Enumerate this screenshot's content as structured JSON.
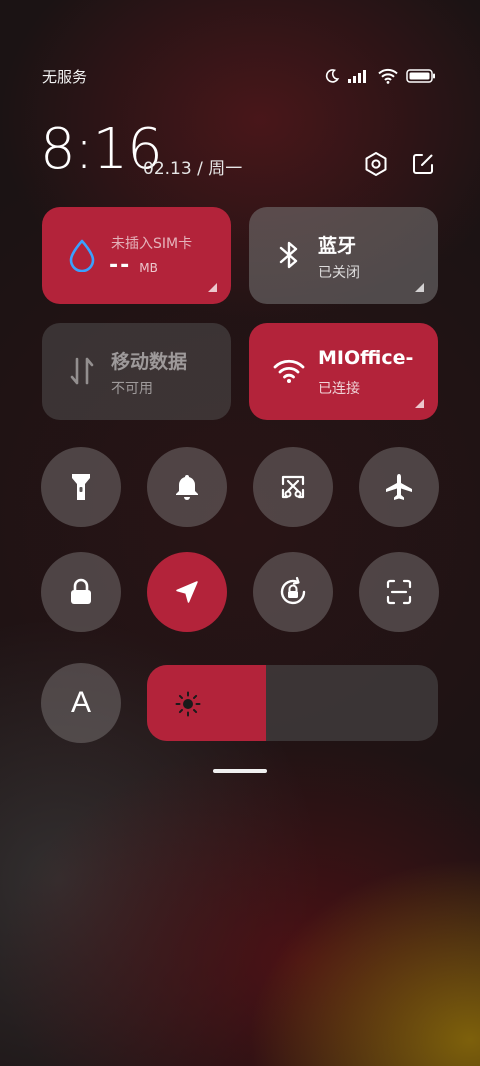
{
  "status_bar": {
    "carrier": "无服务",
    "icons": [
      "moon-icon",
      "signal-icon",
      "wifi-icon",
      "battery-icon"
    ]
  },
  "header": {
    "time": "8:16",
    "date": "02.13 / 周一",
    "settings_icon": "settings-hexagon-icon",
    "edit_icon": "edit-icon"
  },
  "tiles": {
    "data_usage": {
      "title": "未插入SIM卡",
      "value": "--",
      "unit": "MB",
      "icon": "droplet-icon"
    },
    "bluetooth": {
      "title": "蓝牙",
      "status": "已关闭",
      "icon": "bluetooth-icon"
    },
    "mobile_data": {
      "title": "移动数据",
      "status": "不可用",
      "icon": "data-arrows-icon"
    },
    "wifi": {
      "title": "MIOffice-",
      "status": "已连接",
      "icon": "wifi-icon"
    }
  },
  "toggles": [
    {
      "name": "flashlight",
      "icon": "flashlight-icon",
      "active": false
    },
    {
      "name": "ring",
      "icon": "bell-icon",
      "active": false
    },
    {
      "name": "screenshot",
      "icon": "screenshot-icon",
      "active": false
    },
    {
      "name": "airplane",
      "icon": "airplane-icon",
      "active": false
    },
    {
      "name": "lock",
      "icon": "lock-icon",
      "active": false
    },
    {
      "name": "location",
      "icon": "location-arrow-icon",
      "active": true
    },
    {
      "name": "rotation-lock",
      "icon": "rotation-lock-icon",
      "active": false
    },
    {
      "name": "scan",
      "icon": "scan-icon",
      "active": false
    }
  ],
  "auto_brightness": {
    "label": "A"
  },
  "brightness": {
    "level": 0.41,
    "icon": "sun-icon"
  },
  "colors": {
    "accent": "#b3233a",
    "tile_gray": "#787878"
  }
}
